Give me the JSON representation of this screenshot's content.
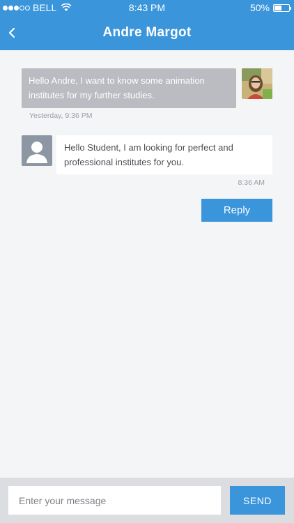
{
  "status_bar": {
    "carrier": "BELL",
    "time": "8:43 PM",
    "battery": "50%"
  },
  "header": {
    "title": "Andre Margot"
  },
  "messages": [
    {
      "text": "Hello Andre, I want to know some animation institutes for my further studies.",
      "time": "Yesterday, 9:36 PM"
    },
    {
      "text": "Hello Student, I am looking for perfect and professional institutes for you.",
      "time": "8:36 AM"
    }
  ],
  "actions": {
    "reply_label": "Reply"
  },
  "composer": {
    "placeholder": "Enter your message",
    "send_label": "SEND"
  },
  "colors": {
    "accent": "#3a95db",
    "outgoing_bubble": "#babcc1",
    "background": "#f4f5f7"
  }
}
